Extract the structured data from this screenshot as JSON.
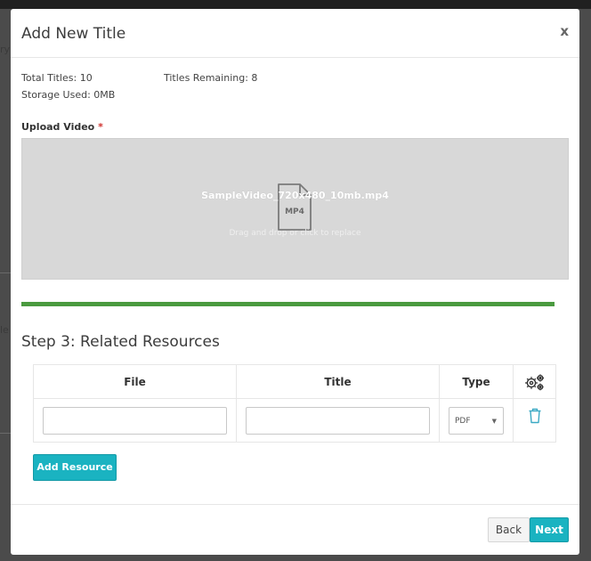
{
  "modal": {
    "title": "Add New Title",
    "close_label": "x"
  },
  "stats": {
    "total_titles": "Total Titles: 10",
    "titles_remaining": "Titles Remaining: 8",
    "storage_used": "Storage Used: 0MB"
  },
  "upload": {
    "label": "Upload Video",
    "required_mark": "*",
    "file_name": "SampleVideo_720x480_10mb.mp4",
    "file_ext": "MP4",
    "hint": "Drag and drop or click to replace",
    "progress_percent": 100
  },
  "step": {
    "title": "Step 3: Related Resources"
  },
  "resources_table": {
    "columns": [
      "File",
      "Title",
      "Type"
    ],
    "rows": [
      {
        "file": "",
        "title": "",
        "type": "PDF"
      }
    ]
  },
  "buttons": {
    "add_resource": "Add Resource",
    "back": "Back",
    "next": "Next"
  },
  "colors": {
    "accent": "#1ab3c1",
    "progress": "#4a9a3f",
    "required": "#d0312d",
    "trash": "#3aa9c4"
  },
  "icons": {
    "settings": "gears-icon",
    "delete": "trash-icon",
    "file": "file-icon",
    "caret": "caret-down-icon"
  },
  "background": {
    "fragments": [
      "ry",
      "le"
    ]
  }
}
